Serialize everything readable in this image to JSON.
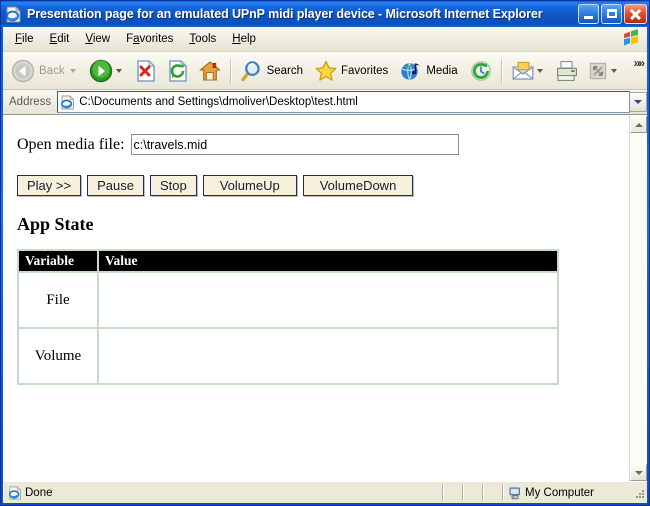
{
  "window": {
    "title": "Presentation page for an emulated UPnP midi player device - Microsoft Internet Explorer",
    "title_icon": "ie-page-icon",
    "buttons": {
      "minimize": "minimize-button",
      "restore": "restore-button",
      "close": "close-button"
    }
  },
  "menubar": {
    "items": [
      {
        "label": "File",
        "accel": "F",
        "rest": "ile"
      },
      {
        "label": "Edit",
        "accel": "E",
        "rest": "dit"
      },
      {
        "label": "View",
        "accel": "V",
        "rest": "iew"
      },
      {
        "label": "Favorites",
        "accel": "a",
        "pre": "F",
        "rest": "vorites"
      },
      {
        "label": "Tools",
        "accel": "T",
        "rest": "ools"
      },
      {
        "label": "Help",
        "accel": "H",
        "rest": "elp"
      }
    ],
    "flag_icon": "windows-flag-icon"
  },
  "toolbar": {
    "back_label": "Back",
    "back_icon": "back-arrow-icon",
    "forward_icon": "forward-arrow-icon",
    "stop_icon": "stop-icon",
    "refresh_icon": "refresh-icon",
    "home_icon": "home-icon",
    "search_label": "Search",
    "search_icon": "search-icon",
    "favorites_label": "Favorites",
    "favorites_icon": "star-icon",
    "media_label": "Media",
    "media_icon": "media-globe-icon",
    "history_icon": "history-icon",
    "mail_icon": "mail-icon",
    "print_icon": "print-icon",
    "edit_icon": "edit-page-icon",
    "overflow_label": "»»"
  },
  "address": {
    "label": "Address",
    "icon": "ie-document-icon",
    "value": "C:\\Documents and Settings\\dmoliver\\Desktop\\test.html",
    "dropdown_icon": "chevron-down-icon"
  },
  "page": {
    "media_field_label": "Open media file:",
    "media_field_value": "c:\\travels.mid",
    "media_field_placeholder": "",
    "controls": [
      {
        "label": "Play >>",
        "name": "play-button",
        "wide": false
      },
      {
        "label": "Pause",
        "name": "pause-button",
        "wide": false
      },
      {
        "label": "Stop",
        "name": "stop-button",
        "wide": false
      },
      {
        "label": "VolumeUp",
        "name": "volume-up-button",
        "wide": true
      },
      {
        "label": "VolumeDown",
        "name": "volume-down-button",
        "wide": true
      }
    ],
    "app_state_heading": "App State",
    "table": {
      "headers": [
        "Variable",
        "Value"
      ],
      "rows": [
        {
          "variable": "File",
          "value": ""
        },
        {
          "variable": "Volume",
          "value": ""
        }
      ],
      "border_color": "#c4ddc4",
      "header_bg": "#000000",
      "header_fg": "#ffffff"
    }
  },
  "scrollbar": {
    "up_icon": "scroll-up-arrow-icon",
    "down_icon": "scroll-down-arrow-icon"
  },
  "statusbar": {
    "status_text": "Done",
    "status_icon": "ie-document-icon",
    "zone_text": "My Computer",
    "zone_icon": "my-computer-icon"
  },
  "colors": {
    "titlebar_blue": "#0a5ad4",
    "chrome_beige": "#ece9d8",
    "button_face": "#f6f1dc",
    "button_border": "#1a2a6b",
    "table_border": "#c4ddc4",
    "close_red": "#e4512a"
  }
}
